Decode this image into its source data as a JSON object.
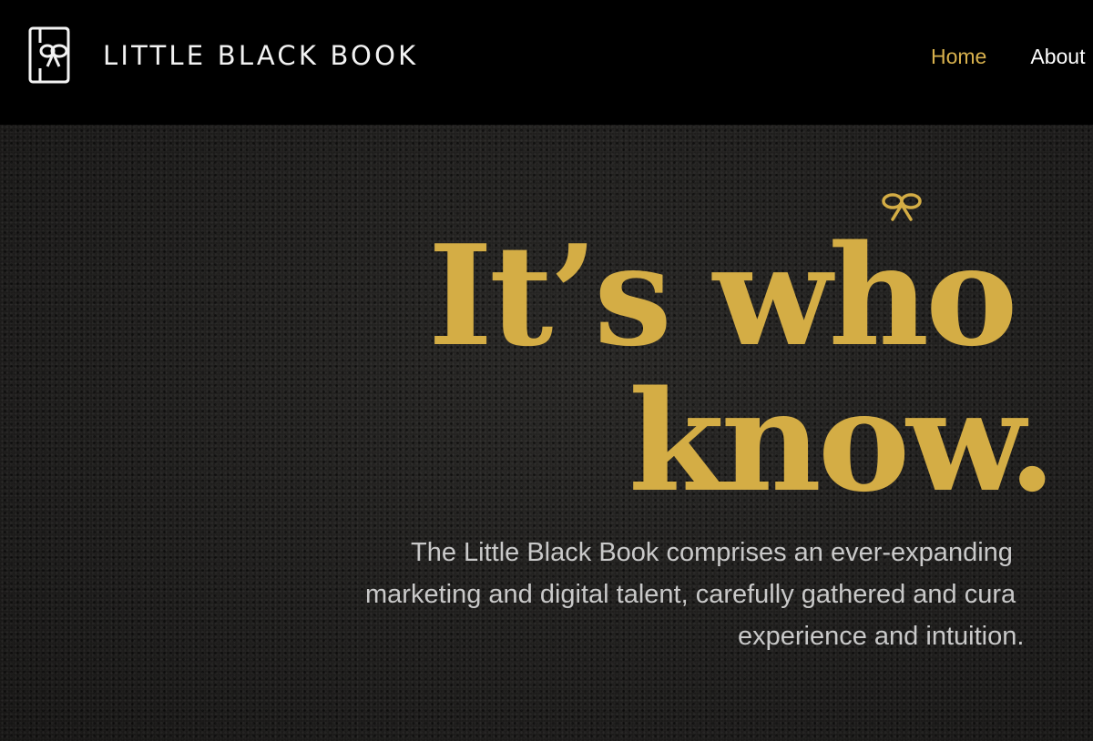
{
  "brand": {
    "name": "LITTLE BLACK BOOK",
    "logo_icon": "book-with-bow-icon",
    "accent_color": "#d4ad45"
  },
  "nav": {
    "items": [
      {
        "label": "Home",
        "active": true
      },
      {
        "label": "About",
        "active": false
      }
    ]
  },
  "hero": {
    "icon": "bow-icon",
    "headline_line1": "It’s who",
    "headline_line2": "know.",
    "tagline_lines": [
      "The Little Black Book comprises an ever-expanding",
      "marketing and digital talent, carefully gathered and cura",
      "experience and intuition."
    ]
  }
}
